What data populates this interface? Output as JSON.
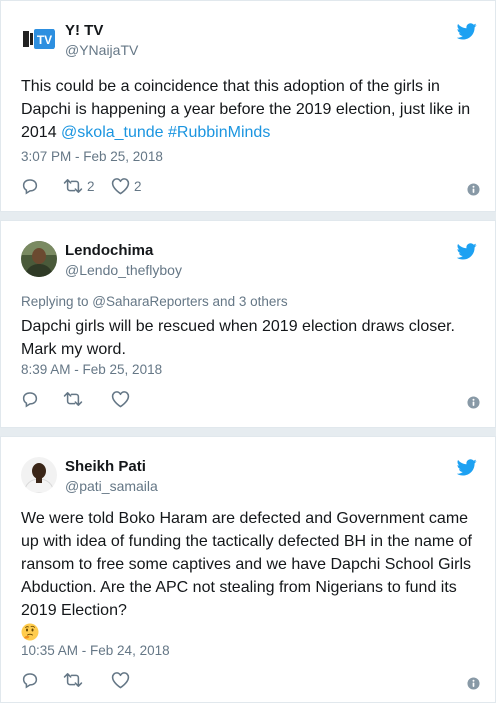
{
  "tweets": [
    {
      "name": "Y! TV",
      "handle": "@YNaijaTV",
      "text_plain": "This could be a coincidence that this adoption of the girls in Dapchi is happening a year before the 2019 election, just like in 2014 ",
      "mention": "@skola_tunde",
      "hashtag": "#RubbinMinds",
      "time": "3:07 PM - Feb 25, 2018",
      "retweets": "2",
      "likes": "2"
    },
    {
      "name": "Lendochima",
      "handle": "@Lendo_theflyboy",
      "replying_to": "Replying to @SaharaReporters and 3 others",
      "text_plain": "Dapchi girls will be rescued when 2019 election draws closer. Mark my word.",
      "time": "8:39 AM - Feb 25, 2018",
      "retweets": "",
      "likes": ""
    },
    {
      "name": "Sheikh Pati",
      "handle": "@pati_samaila",
      "text_plain": "We were told Boko Haram are defected and Government came up with idea of funding the tactically defected BH in the name of ransom to free some captives and we have Dapchi School Girls Abduction. Are the APC not stealing from Nigerians to fund its 2019 Election?",
      "emoji": "thinking-face",
      "time": "10:35 AM - Feb 24, 2018",
      "retweets": "",
      "likes": ""
    }
  ],
  "icons": {
    "brand": "twitter-bird-icon",
    "reply": "reply-icon",
    "retweet": "retweet-icon",
    "like": "heart-icon",
    "info": "info-icon"
  },
  "colors": {
    "twitter_blue": "#1da1f2",
    "link": "#1b95e0",
    "muted": "#657786",
    "text": "#14171a",
    "border": "#e1e8ed",
    "separator": "#e6ecf0"
  }
}
